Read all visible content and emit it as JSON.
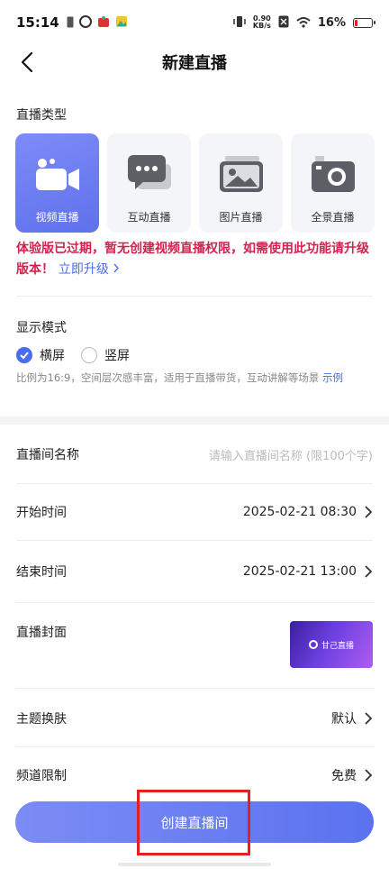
{
  "status_bar": {
    "time": "15:14",
    "net_speed_value": "0.90",
    "net_speed_unit": "KB/s",
    "battery": "16%"
  },
  "nav": {
    "title": "新建直播"
  },
  "live_type": {
    "label": "直播类型",
    "options": [
      {
        "label": "视频直播",
        "icon": "video-camera-icon",
        "selected": true
      },
      {
        "label": "互动直播",
        "icon": "chat-bubbles-icon",
        "selected": false
      },
      {
        "label": "图片直播",
        "icon": "picture-icon",
        "selected": false
      },
      {
        "label": "全景直播",
        "icon": "panorama-camera-icon",
        "selected": false
      }
    ]
  },
  "warning": {
    "text": "体验版已过期，暂无创建视频直播权限，如需使用此功能请升级版本！",
    "upgrade_link": "立即升级"
  },
  "display_mode": {
    "label": "显示模式",
    "options": [
      {
        "label": "横屏",
        "selected": true
      },
      {
        "label": "竖屏",
        "selected": false
      }
    ],
    "hint": "比例为16:9，空间层次感丰富，适用于直播带货，互动讲解等场景 ",
    "hint_link": "示例"
  },
  "form": {
    "room_name": {
      "label": "直播间名称",
      "placeholder": "请输入直播间名称 (限100个字)"
    },
    "start_time": {
      "label": "开始时间",
      "value": "2025-02-21 08:30"
    },
    "end_time": {
      "label": "结束时间",
      "value": "2025-02-21 13:00"
    },
    "cover": {
      "label": "直播封面",
      "cover_text": "甘己直播"
    },
    "theme": {
      "label": "主题换肤",
      "value": "默认"
    },
    "channel_limit": {
      "label": "频道限制",
      "value": "免费"
    }
  },
  "create_button": {
    "label": "创建直播间"
  },
  "colors": {
    "accent": "#4a6cf0",
    "warning": "#d4224e",
    "annotation": "#e31f1f"
  }
}
